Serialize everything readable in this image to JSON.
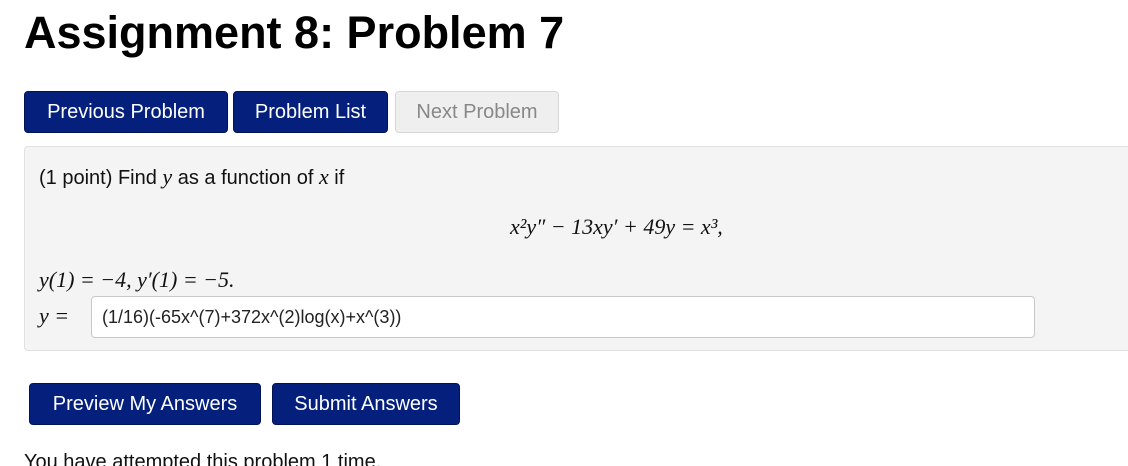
{
  "page": {
    "title": "Assignment 8: Problem 7"
  },
  "nav": {
    "previous_label": "Previous Problem",
    "list_label": "Problem List",
    "next_label": "Next Problem"
  },
  "problem": {
    "points": "(1 point)",
    "prompt_find": "Find",
    "prompt_var_y": "y",
    "prompt_middle": "as a function of",
    "prompt_var_x": "x",
    "prompt_end": "if",
    "equation_text": "x²y″ − 13xy′ + 49y = x³,",
    "condition_text": "y(1) = −4,  y′(1) = −5.",
    "answer_label": "y =",
    "answer_value": "(1/16)(-65x^(7)+372x^(2)log(x)+x^(3))"
  },
  "actions": {
    "preview_label": "Preview My Answers",
    "submit_label": "Submit Answers"
  },
  "status": {
    "attempt_text": "You have attempted this problem 1 time."
  },
  "colors": {
    "primary_button": "#04207c",
    "disabled_button": "#efefef",
    "problem_background": "#f4f4f4"
  }
}
